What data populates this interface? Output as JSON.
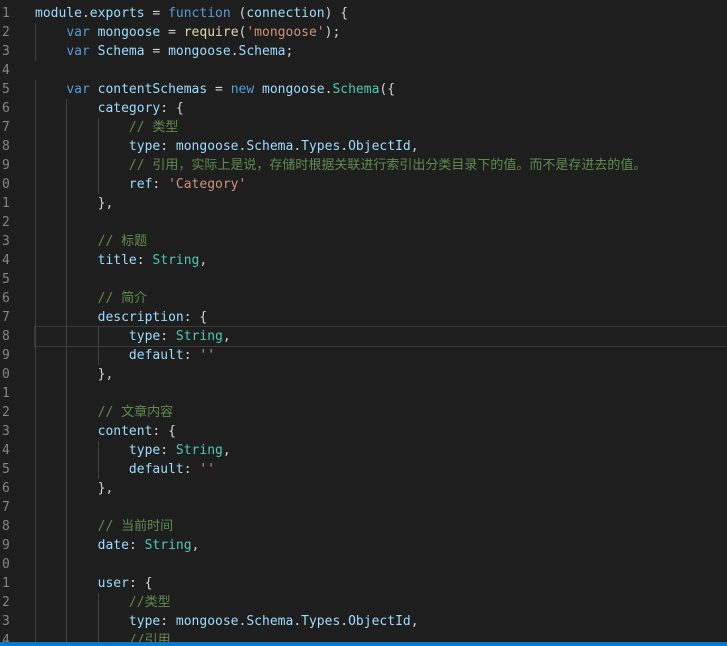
{
  "editor": {
    "current_line": 18,
    "colors": {
      "background": "#1e1e1e",
      "keyword": "#569cd6",
      "variable": "#9cdcfe",
      "function": "#dcdcaa",
      "class": "#4ec9b0",
      "string": "#ce9178",
      "comment": "#608b4e",
      "line_number": "#858585",
      "status_bar": "#007acc"
    },
    "lines": [
      {
        "n": "1",
        "indent": 0,
        "tokens": [
          {
            "t": "var",
            "v": "module"
          },
          {
            "t": "punc",
            "v": "."
          },
          {
            "t": "var",
            "v": "exports"
          },
          {
            "t": "punc",
            "v": " = "
          },
          {
            "t": "kw",
            "v": "function"
          },
          {
            "t": "punc",
            "v": " ("
          },
          {
            "t": "var",
            "v": "connection"
          },
          {
            "t": "punc",
            "v": ") {"
          }
        ]
      },
      {
        "n": "2",
        "indent": 1,
        "tokens": [
          {
            "t": "kw",
            "v": "var"
          },
          {
            "t": "punc",
            "v": " "
          },
          {
            "t": "var",
            "v": "mongoose"
          },
          {
            "t": "punc",
            "v": " = "
          },
          {
            "t": "fn",
            "v": "require"
          },
          {
            "t": "punc",
            "v": "("
          },
          {
            "t": "str",
            "v": "'mongoose'"
          },
          {
            "t": "punc",
            "v": ");"
          }
        ]
      },
      {
        "n": "3",
        "indent": 1,
        "tokens": [
          {
            "t": "kw",
            "v": "var"
          },
          {
            "t": "punc",
            "v": " "
          },
          {
            "t": "var",
            "v": "Schema"
          },
          {
            "t": "punc",
            "v": " = "
          },
          {
            "t": "var",
            "v": "mongoose"
          },
          {
            "t": "punc",
            "v": "."
          },
          {
            "t": "var",
            "v": "Schema"
          },
          {
            "t": "punc",
            "v": ";"
          }
        ]
      },
      {
        "n": "4",
        "indent": 0,
        "tokens": []
      },
      {
        "n": "5",
        "indent": 1,
        "tokens": [
          {
            "t": "kw",
            "v": "var"
          },
          {
            "t": "punc",
            "v": " "
          },
          {
            "t": "var",
            "v": "contentSchemas"
          },
          {
            "t": "punc",
            "v": " = "
          },
          {
            "t": "kw",
            "v": "new"
          },
          {
            "t": "punc",
            "v": " "
          },
          {
            "t": "var",
            "v": "mongoose"
          },
          {
            "t": "punc",
            "v": "."
          },
          {
            "t": "cls",
            "v": "Schema"
          },
          {
            "t": "punc",
            "v": "({"
          }
        ]
      },
      {
        "n": "6",
        "indent": 2,
        "tokens": [
          {
            "t": "var",
            "v": "category"
          },
          {
            "t": "punc",
            "v": ": {"
          }
        ]
      },
      {
        "n": "7",
        "indent": 3,
        "tokens": [
          {
            "t": "cmt",
            "v": "// 类型"
          }
        ]
      },
      {
        "n": "8",
        "indent": 3,
        "tokens": [
          {
            "t": "var",
            "v": "type"
          },
          {
            "t": "punc",
            "v": ": "
          },
          {
            "t": "var",
            "v": "mongoose"
          },
          {
            "t": "punc",
            "v": "."
          },
          {
            "t": "var",
            "v": "Schema"
          },
          {
            "t": "punc",
            "v": "."
          },
          {
            "t": "var",
            "v": "Types"
          },
          {
            "t": "punc",
            "v": "."
          },
          {
            "t": "var",
            "v": "ObjectId"
          },
          {
            "t": "punc",
            "v": ","
          }
        ]
      },
      {
        "n": "9",
        "indent": 3,
        "tokens": [
          {
            "t": "cmt",
            "v": "// 引用，实际上是说，存储时根据关联进行索引出分类目录下的值。而不是存进去的值。"
          }
        ]
      },
      {
        "n": "0",
        "indent": 3,
        "tokens": [
          {
            "t": "var",
            "v": "ref"
          },
          {
            "t": "punc",
            "v": ": "
          },
          {
            "t": "str",
            "v": "'Category'"
          }
        ]
      },
      {
        "n": "1",
        "indent": 2,
        "tokens": [
          {
            "t": "punc",
            "v": "},"
          }
        ]
      },
      {
        "n": "2",
        "indent": 2,
        "tokens": []
      },
      {
        "n": "3",
        "indent": 2,
        "tokens": [
          {
            "t": "cmt",
            "v": "// 标题"
          }
        ]
      },
      {
        "n": "4",
        "indent": 2,
        "tokens": [
          {
            "t": "var",
            "v": "title"
          },
          {
            "t": "punc",
            "v": ": "
          },
          {
            "t": "cls",
            "v": "String"
          },
          {
            "t": "punc",
            "v": ","
          }
        ]
      },
      {
        "n": "5",
        "indent": 2,
        "tokens": []
      },
      {
        "n": "6",
        "indent": 2,
        "tokens": [
          {
            "t": "cmt",
            "v": "// 简介"
          }
        ]
      },
      {
        "n": "7",
        "indent": 2,
        "tokens": [
          {
            "t": "var",
            "v": "description"
          },
          {
            "t": "punc",
            "v": ": {"
          }
        ]
      },
      {
        "n": "8",
        "indent": 3,
        "tokens": [
          {
            "t": "var",
            "v": "type"
          },
          {
            "t": "punc",
            "v": ": "
          },
          {
            "t": "cls",
            "v": "String"
          },
          {
            "t": "punc",
            "v": ","
          }
        ]
      },
      {
        "n": "9",
        "indent": 3,
        "tokens": [
          {
            "t": "var",
            "v": "default"
          },
          {
            "t": "punc",
            "v": ": "
          },
          {
            "t": "str",
            "v": "''"
          }
        ]
      },
      {
        "n": "0",
        "indent": 2,
        "tokens": [
          {
            "t": "punc",
            "v": "},"
          }
        ]
      },
      {
        "n": "1",
        "indent": 2,
        "tokens": []
      },
      {
        "n": "2",
        "indent": 2,
        "tokens": [
          {
            "t": "cmt",
            "v": "// 文章内容"
          }
        ]
      },
      {
        "n": "3",
        "indent": 2,
        "tokens": [
          {
            "t": "var",
            "v": "content"
          },
          {
            "t": "punc",
            "v": ": {"
          }
        ]
      },
      {
        "n": "4",
        "indent": 3,
        "tokens": [
          {
            "t": "var",
            "v": "type"
          },
          {
            "t": "punc",
            "v": ": "
          },
          {
            "t": "cls",
            "v": "String"
          },
          {
            "t": "punc",
            "v": ","
          }
        ]
      },
      {
        "n": "5",
        "indent": 3,
        "tokens": [
          {
            "t": "var",
            "v": "default"
          },
          {
            "t": "punc",
            "v": ": "
          },
          {
            "t": "str",
            "v": "''"
          }
        ]
      },
      {
        "n": "6",
        "indent": 2,
        "tokens": [
          {
            "t": "punc",
            "v": "},"
          }
        ]
      },
      {
        "n": "7",
        "indent": 2,
        "tokens": []
      },
      {
        "n": "8",
        "indent": 2,
        "tokens": [
          {
            "t": "cmt",
            "v": "// 当前时间"
          }
        ]
      },
      {
        "n": "9",
        "indent": 2,
        "tokens": [
          {
            "t": "var",
            "v": "date"
          },
          {
            "t": "punc",
            "v": ": "
          },
          {
            "t": "cls",
            "v": "String"
          },
          {
            "t": "punc",
            "v": ","
          }
        ]
      },
      {
        "n": "0",
        "indent": 2,
        "tokens": []
      },
      {
        "n": "1",
        "indent": 2,
        "tokens": [
          {
            "t": "var",
            "v": "user"
          },
          {
            "t": "punc",
            "v": ": {"
          }
        ]
      },
      {
        "n": "2",
        "indent": 3,
        "tokens": [
          {
            "t": "cmt",
            "v": "//类型"
          }
        ]
      },
      {
        "n": "3",
        "indent": 3,
        "tokens": [
          {
            "t": "var",
            "v": "type"
          },
          {
            "t": "punc",
            "v": ": "
          },
          {
            "t": "var",
            "v": "mongoose"
          },
          {
            "t": "punc",
            "v": "."
          },
          {
            "t": "var",
            "v": "Schema"
          },
          {
            "t": "punc",
            "v": "."
          },
          {
            "t": "var",
            "v": "Types"
          },
          {
            "t": "punc",
            "v": "."
          },
          {
            "t": "var",
            "v": "ObjectId"
          },
          {
            "t": "punc",
            "v": ","
          }
        ]
      },
      {
        "n": "4",
        "indent": 3,
        "tokens": [
          {
            "t": "cmt",
            "v": "//引用"
          }
        ]
      }
    ]
  }
}
